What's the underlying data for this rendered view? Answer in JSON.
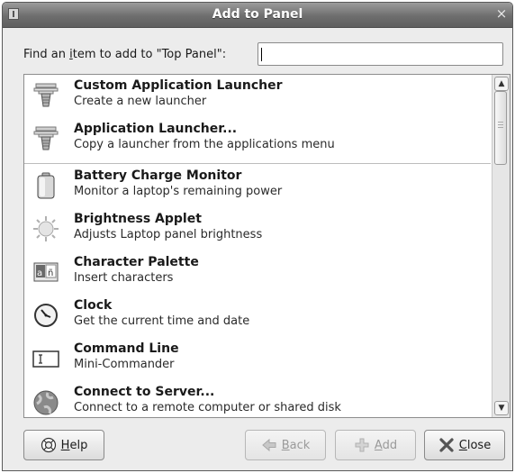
{
  "window": {
    "title": "Add to Panel",
    "close_glyph": "×"
  },
  "search": {
    "label_pre": "Find an ",
    "label_mnemonic": "i",
    "label_post": "tem to add to \"Top Panel\":",
    "value": "",
    "placeholder": ""
  },
  "items": [
    {
      "name": "Custom Application Launcher",
      "description": "Create a new launcher",
      "icon": "launcher-icon"
    },
    {
      "name": "Application Launcher...",
      "description": "Copy a launcher from the applications menu",
      "icon": "launcher-icon"
    },
    {
      "name": "Battery Charge Monitor",
      "description": "Monitor a laptop's remaining power",
      "icon": "battery-icon"
    },
    {
      "name": "Brightness Applet",
      "description": "Adjusts Laptop panel brightness",
      "icon": "brightness-icon"
    },
    {
      "name": "Character Palette",
      "description": "Insert characters",
      "icon": "character-palette-icon"
    },
    {
      "name": "Clock",
      "description": "Get the current time and date",
      "icon": "clock-icon"
    },
    {
      "name": "Command Line",
      "description": "Mini-Commander",
      "icon": "command-line-icon"
    },
    {
      "name": "Connect to Server...",
      "description": "Connect to a remote computer or shared disk",
      "icon": "network-globe-icon"
    }
  ],
  "buttons": {
    "help": {
      "mnemonic": "H",
      "rest": "elp"
    },
    "back": {
      "mnemonic": "B",
      "rest": "ack"
    },
    "add": {
      "mnemonic": "A",
      "rest": "dd"
    },
    "close": {
      "mnemonic": "C",
      "rest": "lose"
    }
  },
  "scrollbar": {
    "up_glyph": "▲",
    "down_glyph": "▼"
  }
}
